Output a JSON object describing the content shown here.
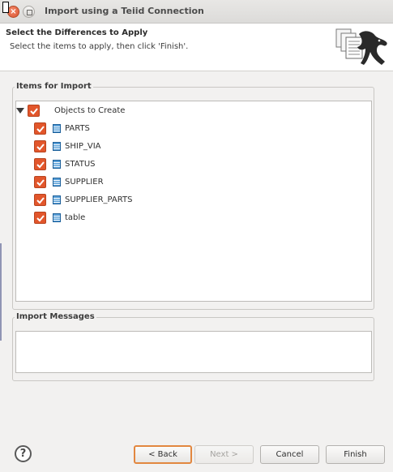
{
  "window": {
    "title": "Import using a Teiid Connection"
  },
  "header": {
    "title": "Select the Differences to Apply",
    "description": "Select the items to apply, then click 'Finish'."
  },
  "items_group": {
    "label": "Items for Import",
    "root": {
      "label": "Objects to Create",
      "checked": true,
      "expanded": true
    },
    "children": [
      {
        "label": "PARTS",
        "checked": true
      },
      {
        "label": "SHIP_VIA",
        "checked": true
      },
      {
        "label": "STATUS",
        "checked": true
      },
      {
        "label": "SUPPLIER",
        "checked": true
      },
      {
        "label": "SUPPLIER_PARTS",
        "checked": true
      },
      {
        "label": "table",
        "checked": true
      }
    ]
  },
  "messages_group": {
    "label": "Import Messages"
  },
  "footer": {
    "help_label": "?",
    "back_label": "< Back",
    "next_label": "Next >",
    "cancel_label": "Cancel",
    "finish_label": "Finish"
  },
  "colors": {
    "checkbox": "#e2562b",
    "focus_ring": "#e2873f"
  }
}
